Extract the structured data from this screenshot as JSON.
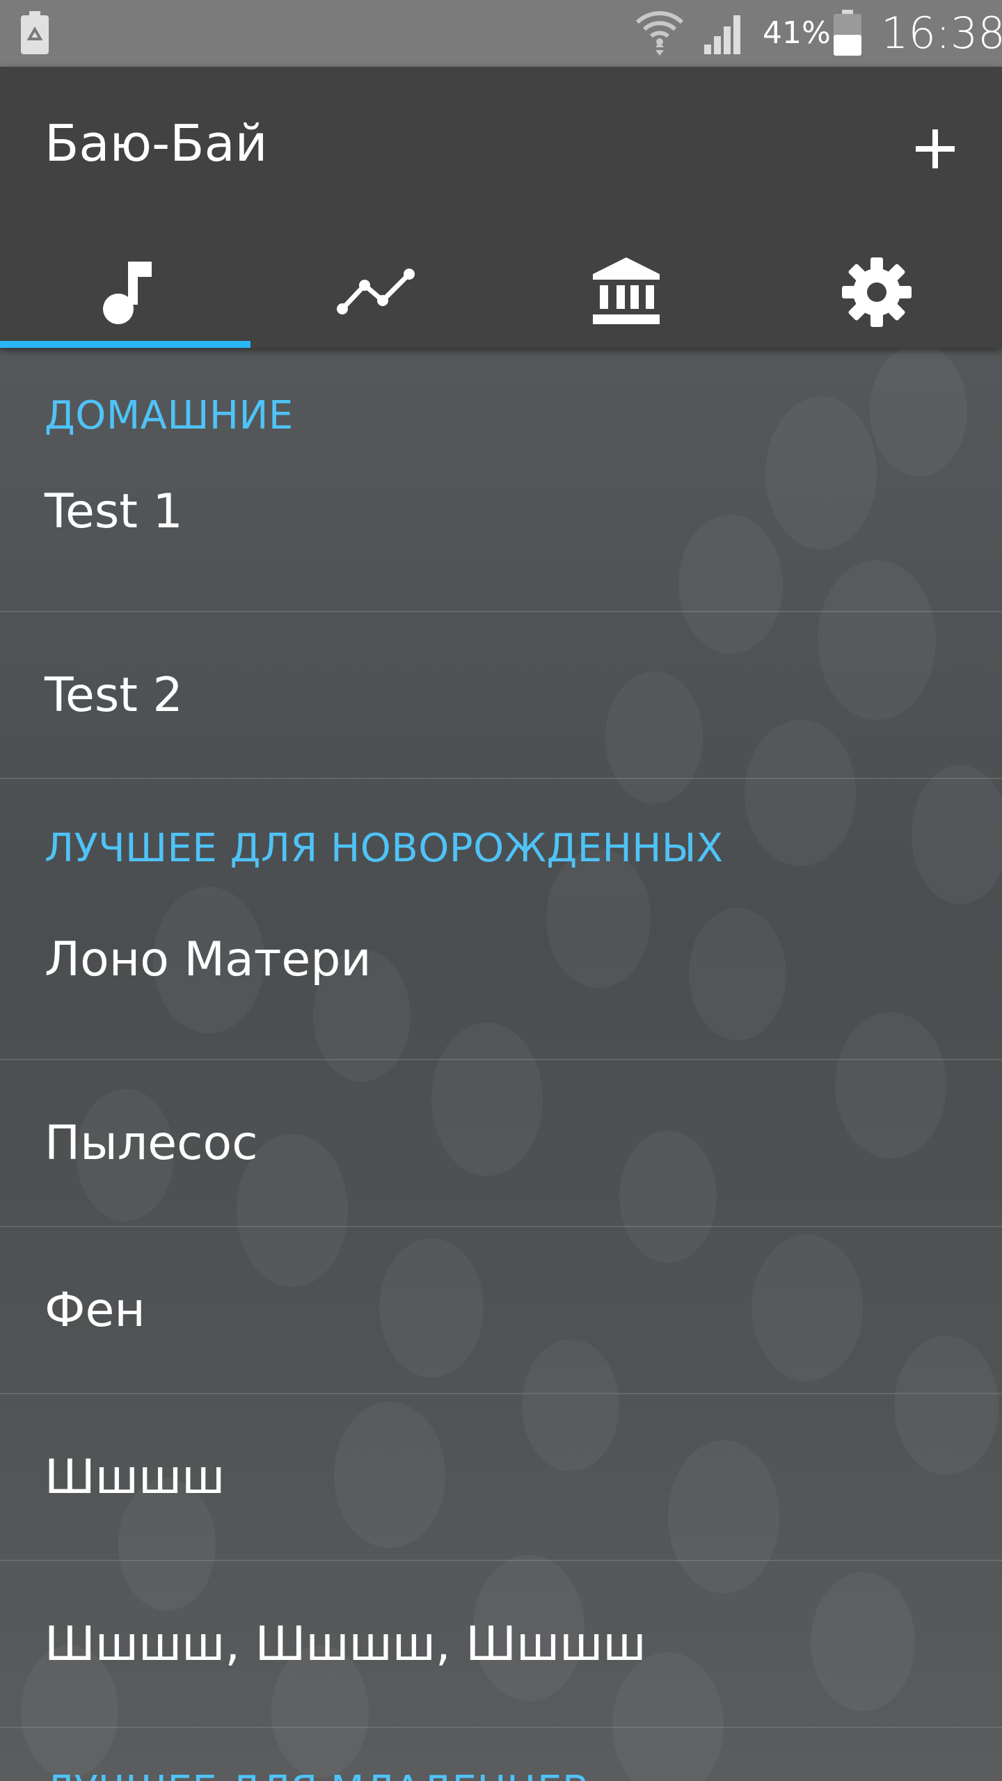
{
  "status_bar": {
    "battery_percent": "41%",
    "time": "16:38",
    "icons": [
      "battery-saver-icon",
      "wifi-icon",
      "cell-signal-icon",
      "battery-icon"
    ]
  },
  "app_bar": {
    "title": "Баю-Бай",
    "add_icon": "plus-icon"
  },
  "tabs": [
    {
      "icon": "music-note-icon",
      "selected": true
    },
    {
      "icon": "chart-line-icon",
      "selected": false
    },
    {
      "icon": "bank-icon",
      "selected": false
    },
    {
      "icon": "gear-icon",
      "selected": false
    }
  ],
  "colors": {
    "accent": "#29b6f6",
    "section_header": "#4fc3f7",
    "app_bar": "#424242",
    "status_bar": "#7b7b7b"
  },
  "sections": [
    {
      "header": "ДОМАШНИЕ",
      "items": [
        "Test 1",
        "Test 2"
      ]
    },
    {
      "header": "ЛУЧШЕЕ ДЛЯ НОВОРОЖДЕННЫХ",
      "items": [
        "Лоно Матери",
        "Пылесос",
        "Фен",
        "Шшшш",
        "Шшшш, Шшшш, Шшшш"
      ]
    },
    {
      "header": "ЛУЧШЕЕ ДЛЯ МЛАДЕНЦЕВ",
      "items": []
    }
  ]
}
